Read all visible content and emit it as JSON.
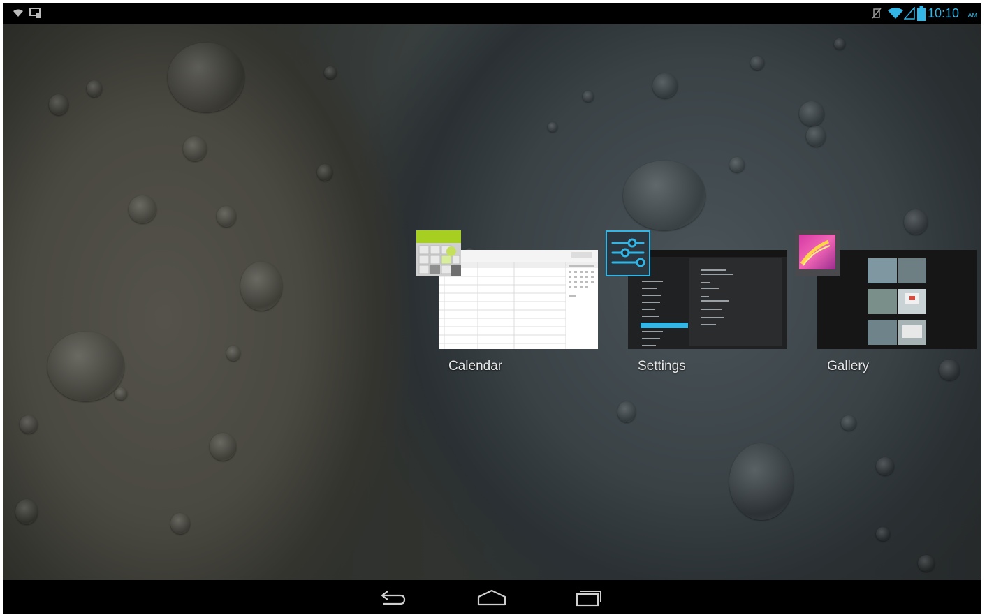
{
  "status_bar": {
    "left_icons": [
      "wifi-notification-icon",
      "screenshot-notification-icon"
    ],
    "right_icons": [
      "no-sim-icon",
      "wifi-signal-icon",
      "cell-signal-icon",
      "battery-icon"
    ],
    "time": "10:10",
    "ampm": "AM",
    "accent_color": "#33b5e5"
  },
  "recent_apps": [
    {
      "label": "Calendar",
      "icon": "calendar-app-icon"
    },
    {
      "label": "Settings",
      "icon": "settings-app-icon"
    },
    {
      "label": "Gallery",
      "icon": "gallery-app-icon"
    }
  ],
  "nav_bar": {
    "buttons": [
      "back-icon",
      "home-icon",
      "recent-apps-icon"
    ]
  }
}
